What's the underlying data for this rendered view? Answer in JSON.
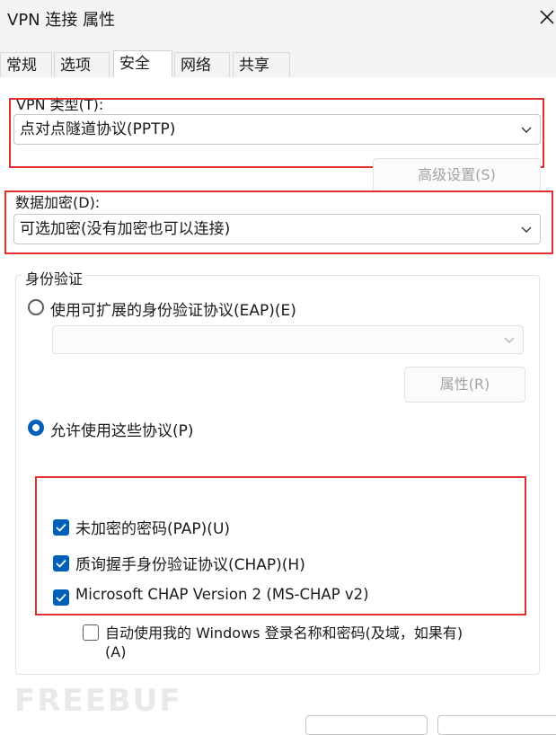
{
  "window": {
    "title": "VPN 连接 属性"
  },
  "tabs": [
    {
      "label": "常规",
      "active": false
    },
    {
      "label": "选项",
      "active": false
    },
    {
      "label": "安全",
      "active": true
    },
    {
      "label": "网络",
      "active": false
    },
    {
      "label": "共享",
      "active": false
    }
  ],
  "security": {
    "vpn_type_label": "VPN 类型(T):",
    "vpn_type_value": "点对点隧道协议(PPTP)",
    "advanced_button": "高级设置(S)",
    "encryption_label": "数据加密(D):",
    "encryption_value": "可选加密(没有加密也可以连接)",
    "auth_group_label": "身份验证",
    "eap_radio_label": "使用可扩展的身份验证协议(EAP)(E)",
    "eap_select_value": "",
    "properties_button": "属性(R)",
    "allow_protocols_label": "允许使用这些协议(P)",
    "pap_label": "未加密的密码(PAP)(U)",
    "chap_label": "质询握手身份验证协议(CHAP)(H)",
    "mschap_label": "Microsoft CHAP Version 2 (MS-CHAP v2)",
    "auto_login_label_line1": "自动使用我的 Windows 登录名称和密码(及域，如果有)",
    "auto_login_label_line2": "(A)"
  },
  "state": {
    "eap_selected": false,
    "allow_protocols_selected": true,
    "pap_checked": true,
    "chap_checked": true,
    "mschap_checked": true,
    "auto_login_checked": false
  },
  "watermark": "FREEBUF",
  "colors": {
    "accent": "#005fb8",
    "highlight_box": "#e03030"
  }
}
